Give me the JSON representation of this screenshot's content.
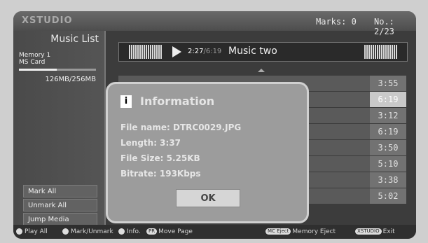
{
  "header": {
    "logo": "XSTUDIO",
    "marks": "Marks: 0",
    "number": "No.: 2/23"
  },
  "sidebar": {
    "title": "Music List",
    "memory_line1": "Memory 1",
    "memory_line2": "MS Card",
    "usage": "126MB/256MB",
    "usage_fraction": 0.49,
    "buttons": [
      "Mark All",
      "Unmark All",
      "Jump Media"
    ]
  },
  "now_playing": {
    "elapsed": "2:27",
    "total": "/6:19",
    "title": "Music two"
  },
  "durations": [
    "3:55",
    "6:19",
    "3:12",
    "6:19",
    "3:50",
    "5:10",
    "3:38",
    "5:02"
  ],
  "selected_row": 1,
  "dialog": {
    "icon_text": "i",
    "title": "Information",
    "file_name": "File name: DTRC0029.JPG",
    "length": "Length: 3:37",
    "file_size": "File Size: 5.25KB",
    "bitrate": "Bitrate: 193Kbps",
    "ok_label": "OK"
  },
  "footer": {
    "play_all": "Play All",
    "mark_unmark": "Mark/Unmark",
    "info": "Info.",
    "pr_badge": "PR",
    "move_page": "Move Page",
    "mc_eject_badge": "MC Eject",
    "memory_eject": "Memory Eject",
    "xstudio_badge": "XSTUDIO",
    "exit": "Exit"
  },
  "colors": {
    "accent": "#c9c9c9",
    "screen_bg": "#3c3c3c"
  }
}
